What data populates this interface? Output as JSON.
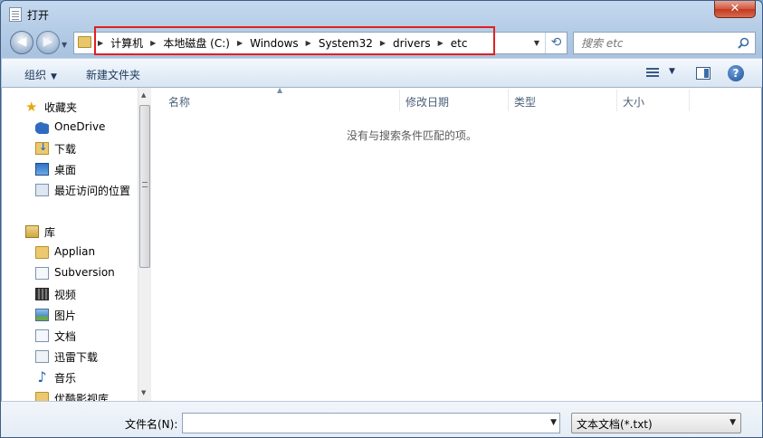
{
  "window": {
    "title": "打开",
    "close_label": "✕"
  },
  "nav": {
    "back_glyph": "◀",
    "forward_glyph": "▶",
    "recent_glyph": "▼"
  },
  "address": {
    "crumbs": [
      "计算机",
      "本地磁盘 (C:)",
      "Windows",
      "System32",
      "drivers",
      "etc"
    ],
    "separator": "▶",
    "dropdown_glyph": "▼",
    "refresh_glyph": "⟲"
  },
  "search": {
    "placeholder": "搜索 etc"
  },
  "toolbar": {
    "organize_label": "组织",
    "organize_caret": "▼",
    "new_folder_label": "新建文件夹",
    "view_caret": "▼",
    "help_label": "?"
  },
  "sidebar": {
    "favorites_label": "收藏夹",
    "favorites": [
      "OneDrive",
      "下载",
      "桌面",
      "最近访问的位置"
    ],
    "libraries_label": "库",
    "libraries": [
      "Applian",
      "Subversion",
      "视频",
      "图片",
      "文档",
      "迅雷下载",
      "音乐",
      "优酷影视库"
    ]
  },
  "scrollbar": {
    "up_glyph": "▲",
    "down_glyph": "▼"
  },
  "filelist": {
    "columns": [
      "名称",
      "修改日期",
      "类型",
      "大小"
    ],
    "sort_arrow": "▲",
    "empty_message": "没有与搜索条件匹配的项。"
  },
  "footer": {
    "filename_label": "文件名(N):",
    "filename_value": "",
    "filename_caret": "▼",
    "filetype_value": "文本文档(*.txt)",
    "filetype_caret": "▼"
  },
  "colors": {
    "highlight_box": "#e02020",
    "accent": "#1e395b"
  }
}
